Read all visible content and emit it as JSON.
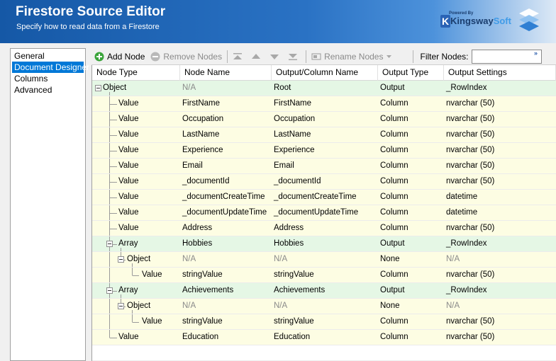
{
  "header": {
    "title": "Firestore Source Editor",
    "subtitle": "Specify how to read data from a Firestore",
    "brand_powered": "Powered By",
    "brand_name_a": "Kingsway",
    "brand_name_b": "Soft"
  },
  "nav": {
    "items": [
      {
        "label": "General",
        "active": false
      },
      {
        "label": "Document Designer",
        "active": true
      },
      {
        "label": "Columns",
        "active": false
      },
      {
        "label": "Advanced",
        "active": false
      }
    ]
  },
  "toolbar": {
    "add_node": "Add Node",
    "remove_nodes": "Remove Nodes",
    "rename_nodes": "Rename Nodes",
    "filter_label": "Filter Nodes:",
    "filter_value": "",
    "more": "»"
  },
  "grid": {
    "columns": [
      "Node Type",
      "Node Name",
      "Output/Column Name",
      "Output Type",
      "Output Settings"
    ],
    "rows": [
      {
        "type": "Object",
        "name": "N/A",
        "out": "Root",
        "otype": "Output",
        "settings": "_RowIndex",
        "kind": "output"
      },
      {
        "type": "Value",
        "name": "FirstName",
        "out": "FirstName",
        "otype": "Column",
        "settings": "nvarchar (50)",
        "kind": "column"
      },
      {
        "type": "Value",
        "name": "Occupation",
        "out": "Occupation",
        "otype": "Column",
        "settings": "nvarchar (50)",
        "kind": "column"
      },
      {
        "type": "Value",
        "name": "LastName",
        "out": "LastName",
        "otype": "Column",
        "settings": "nvarchar (50)",
        "kind": "column"
      },
      {
        "type": "Value",
        "name": "Experience",
        "out": "Experience",
        "otype": "Column",
        "settings": "nvarchar (50)",
        "kind": "column"
      },
      {
        "type": "Value",
        "name": "Email",
        "out": "Email",
        "otype": "Column",
        "settings": "nvarchar (50)",
        "kind": "column"
      },
      {
        "type": "Value",
        "name": "_documentId",
        "out": "_documentId",
        "otype": "Column",
        "settings": "nvarchar (50)",
        "kind": "column"
      },
      {
        "type": "Value",
        "name": "_documentCreateTime",
        "out": "_documentCreateTime",
        "otype": "Column",
        "settings": "datetime",
        "kind": "column"
      },
      {
        "type": "Value",
        "name": "_documentUpdateTime",
        "out": "_documentUpdateTime",
        "otype": "Column",
        "settings": "datetime",
        "kind": "column"
      },
      {
        "type": "Value",
        "name": "Address",
        "out": "Address",
        "otype": "Column",
        "settings": "nvarchar (50)",
        "kind": "column"
      },
      {
        "type": "Array",
        "name": "Hobbies",
        "out": "Hobbies",
        "otype": "Output",
        "settings": "_RowIndex",
        "kind": "output"
      },
      {
        "type": "Object",
        "name": "N/A",
        "out": "N/A",
        "otype": "None",
        "settings": "N/A",
        "kind": "column"
      },
      {
        "type": "Value",
        "name": "stringValue",
        "out": "stringValue",
        "otype": "Column",
        "settings": "nvarchar (50)",
        "kind": "column"
      },
      {
        "type": "Array",
        "name": "Achievements",
        "out": "Achievements",
        "otype": "Output",
        "settings": "_RowIndex",
        "kind": "output"
      },
      {
        "type": "Object",
        "name": "N/A",
        "out": "N/A",
        "otype": "None",
        "settings": "N/A",
        "kind": "column"
      },
      {
        "type": "Value",
        "name": "stringValue",
        "out": "stringValue",
        "otype": "Column",
        "settings": "nvarchar (50)",
        "kind": "column"
      },
      {
        "type": "Value",
        "name": "Education",
        "out": "Education",
        "otype": "Column",
        "settings": "nvarchar (50)",
        "kind": "column"
      }
    ]
  }
}
